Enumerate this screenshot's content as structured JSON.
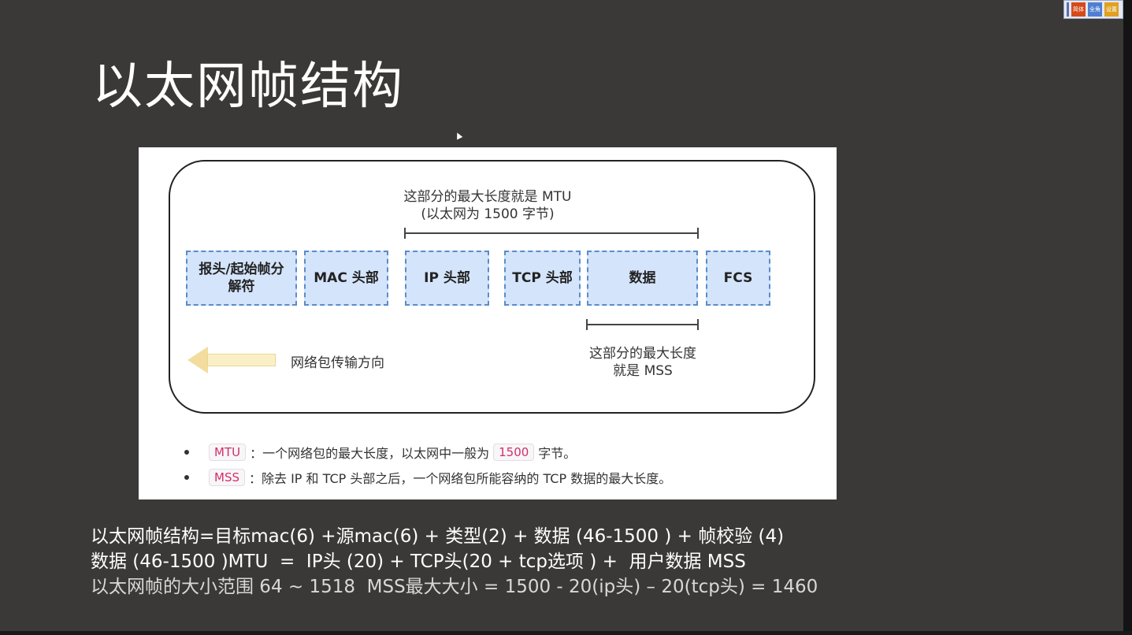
{
  "slide": {
    "title": "以太网帧结构"
  },
  "tray": {
    "icon1": "简体",
    "icon2": "全角",
    "icon3": "设置"
  },
  "figure": {
    "mtu_note_line1": "这部分的最大长度就是 MTU",
    "mtu_note_line2": "(以太网为 1500 字节)",
    "fields": [
      {
        "line1": "报头/起始帧分",
        "line2": "解符"
      },
      {
        "line1": "MAC 头部"
      },
      {
        "line1": "IP 头部"
      },
      {
        "line1": "TCP 头部"
      },
      {
        "line1": "数据"
      },
      {
        "line1": "FCS"
      }
    ],
    "mss_note_line1": "这部分的最大长度",
    "mss_note_line2": "就是 MSS",
    "arrow_label": "网络包传输方向",
    "bullets": [
      {
        "tag": "MTU",
        "text1": "：一个网络包的最大长度，以太网中一般为",
        "tag2": "1500",
        "text2": "字节。"
      },
      {
        "tag": "MSS",
        "text1": "：除去 IP 和 TCP 头部之后，一个网络包所能容纳的 TCP 数据的最大长度。"
      }
    ]
  },
  "formulas": [
    "以太网帧结构=目标mac(6) +源mac(6) + 类型(2) + 数据 (46-1500 ) + 帧校验 (4)",
    "数据 (46-1500 )MTU  =  IP头 (20) + TCP头(20 + tcp选项 ) +  用户数据 MSS",
    "以太网帧的大小范围 64 ~ 1518  MSS最大大小 = 1500 - 20(ip头) – 20(tcp头) = 1460"
  ],
  "colors": {
    "background": "#3b3937",
    "field_fill": "#d4e4fb",
    "field_border": "#5b8cc8",
    "tag_text": "#d0306a",
    "arrow": "#f2dd9e"
  }
}
